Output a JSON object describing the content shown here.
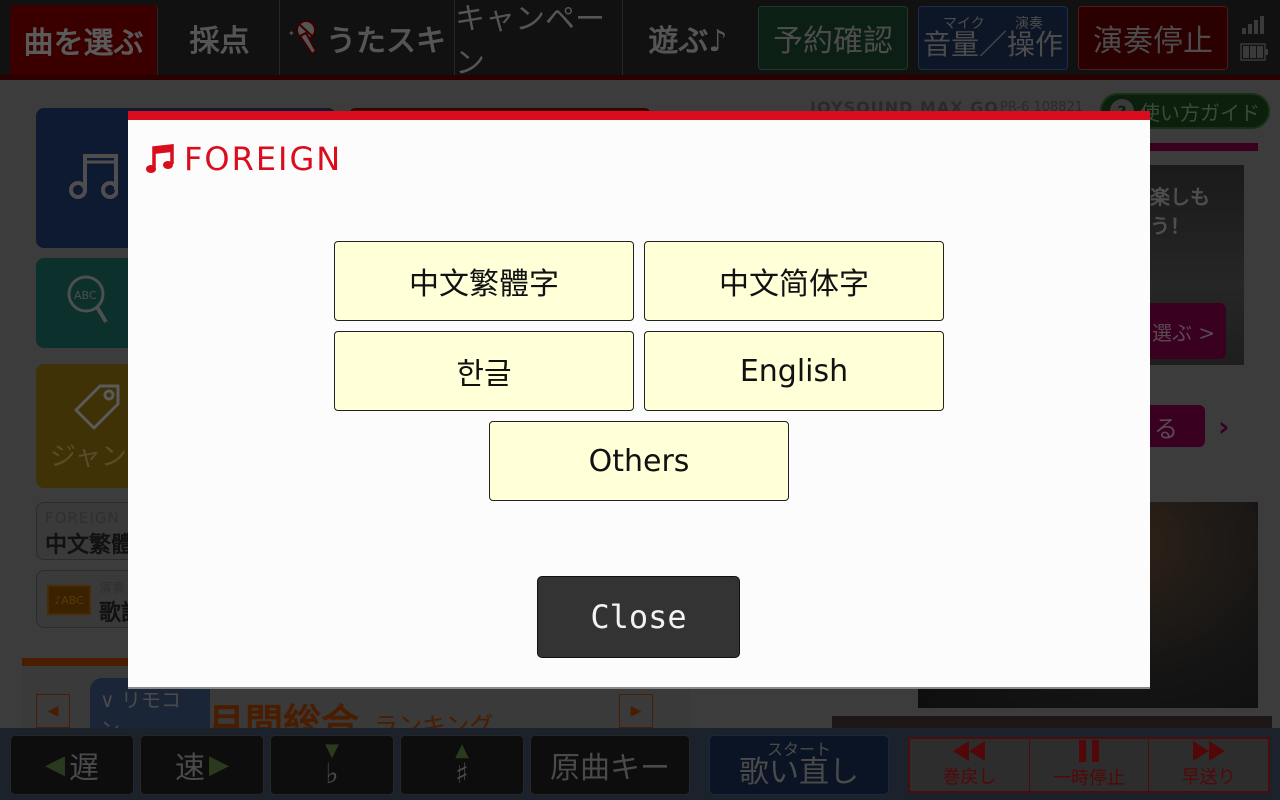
{
  "topnav": {
    "tabs": [
      {
        "label": "曲を選ぶ",
        "active": true
      },
      {
        "label": "採点"
      },
      {
        "label": "うたスキ"
      },
      {
        "label": "キャンペーン"
      },
      {
        "label": "遊ぶ♪"
      }
    ],
    "reserve_label": "予約確認",
    "volume": {
      "mic_label": "マイク",
      "play_label": "演奏",
      "main_label": "音量／操作"
    },
    "stop_label": "演奏停止"
  },
  "background": {
    "brand_text": "JOYSOUND MAX GO",
    "model_text": "PR-6 108821",
    "guide_label": "使い方ガイド",
    "genre_label": "ジャンル",
    "foreign_card": {
      "small": "FOREIGN",
      "big": "中文繁體字"
    },
    "lyrics_card": {
      "badge": "♪ABC",
      "small": "演奏",
      "big": "歌詞"
    },
    "promo_text": "楽しもう！",
    "promo_button": "選ぶ >",
    "promo_button2": "る",
    "ranking_title": "月間総合",
    "ranking_sub": "ランキング",
    "remote_label": "リモコン"
  },
  "modal": {
    "title": "FOREIGN",
    "languages": [
      "中文繁體字",
      "中文简体字",
      "한글",
      "English",
      "Others"
    ],
    "close_label": "Close",
    "accent_color": "#d90d1d",
    "button_color": "#ffffd8"
  },
  "bottombar": {
    "slow_label": "遅",
    "fast_label": "速",
    "flat_label": "♭",
    "sharp_label": "♯",
    "original_key_label": "原曲キー",
    "restart": {
      "small": "スタート",
      "big": "歌い直し"
    },
    "transport": [
      {
        "label": "巻戻し",
        "icon": "rewind-icon"
      },
      {
        "label": "一時停止",
        "icon": "pause-icon"
      },
      {
        "label": "早送り",
        "icon": "fast-forward-icon"
      }
    ]
  }
}
